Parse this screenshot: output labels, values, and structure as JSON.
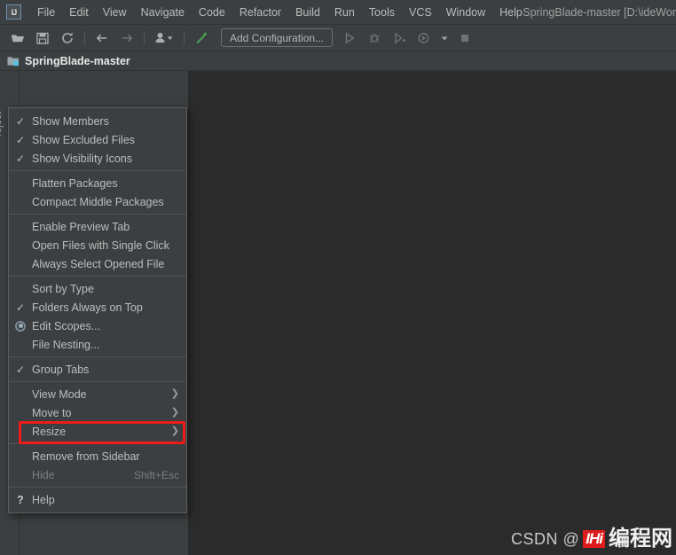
{
  "window": {
    "title": "SpringBlade-master [D:\\ideWor",
    "logo_text": "IJ"
  },
  "menubar": {
    "items": [
      {
        "label": "File"
      },
      {
        "label": "Edit"
      },
      {
        "label": "View"
      },
      {
        "label": "Navigate"
      },
      {
        "label": "Code"
      },
      {
        "label": "Refactor"
      },
      {
        "label": "Build"
      },
      {
        "label": "Run"
      },
      {
        "label": "Tools"
      },
      {
        "label": "VCS"
      },
      {
        "label": "Window"
      },
      {
        "label": "Help"
      }
    ]
  },
  "toolbar": {
    "open_icon": "open-folder-icon",
    "save_icon": "save-icon",
    "sync_icon": "sync-icon",
    "back_icon": "back-arrow-icon",
    "forward_icon": "forward-arrow-icon",
    "profile_icon": "user-profile-icon",
    "build_icon": "build-hammer-icon",
    "add_configuration_label": "Add Configuration...",
    "run_icon": "run-icon",
    "debug_icon": "debug-icon",
    "coverage_icon": "run-with-coverage-icon",
    "profiler_icon": "profiler-icon",
    "stop_icon": "stop-icon"
  },
  "project": {
    "header_title": "SpringBlade-master",
    "tool_window_label": "roject"
  },
  "context_menu": {
    "groups": [
      {
        "items": [
          {
            "label": "Show Members",
            "marker": "check"
          },
          {
            "label": "Show Excluded Files",
            "marker": "check"
          },
          {
            "label": "Show Visibility Icons",
            "marker": "check"
          }
        ]
      },
      {
        "items": [
          {
            "label": "Flatten Packages",
            "marker": "none"
          },
          {
            "label": "Compact Middle Packages",
            "marker": "none"
          }
        ]
      },
      {
        "items": [
          {
            "label": "Enable Preview Tab",
            "marker": "none"
          },
          {
            "label": "Open Files with Single Click",
            "marker": "none"
          },
          {
            "label": "Always Select Opened File",
            "marker": "none"
          }
        ]
      },
      {
        "items": [
          {
            "label": "Sort by Type",
            "marker": "none"
          },
          {
            "label": "Folders Always on Top",
            "marker": "check"
          },
          {
            "label": "Edit Scopes...",
            "marker": "radio"
          },
          {
            "label": "File Nesting...",
            "marker": "none"
          }
        ]
      },
      {
        "items": [
          {
            "label": "Group Tabs",
            "marker": "check"
          }
        ]
      },
      {
        "items": [
          {
            "label": "View Mode",
            "marker": "none",
            "submenu": true
          },
          {
            "label": "Move to",
            "marker": "none",
            "submenu": true
          },
          {
            "label": "Resize",
            "marker": "none",
            "submenu": true
          }
        ]
      },
      {
        "items": [
          {
            "label": "Remove from Sidebar",
            "marker": "none",
            "highlighted": true
          },
          {
            "label": "Hide",
            "marker": "none",
            "shortcut": "Shift+Esc",
            "disabled": true
          }
        ]
      },
      {
        "items": [
          {
            "label": "Help",
            "marker": "question"
          }
        ]
      }
    ],
    "highlight_color": "#ee1b1b"
  },
  "watermark": {
    "prefix": "CSDN @",
    "logo_text": "IHi",
    "text": "编程网"
  },
  "colors": {
    "chrome": "#3c3f41",
    "editor": "#2b2b2b",
    "menu_bg": "#3c3f41",
    "text": "#bdbdbd",
    "accent_red": "#ee1b1b",
    "accent_green": "#499c54"
  }
}
